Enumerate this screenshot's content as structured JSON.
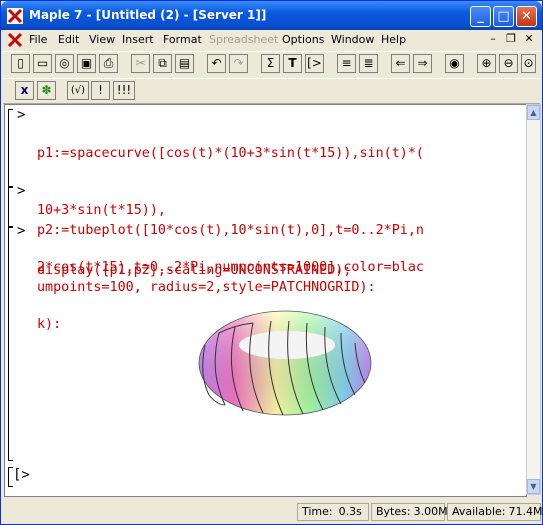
{
  "window": {
    "title": "Maple 7  - [Untitled (2) - [Server 1]]"
  },
  "menu": [
    {
      "label": "File",
      "disabled": false
    },
    {
      "label": "Edit",
      "disabled": false
    },
    {
      "label": "View",
      "disabled": false
    },
    {
      "label": "Insert",
      "disabled": false
    },
    {
      "label": "Format",
      "disabled": false
    },
    {
      "label": "Spreadsheet",
      "disabled": true
    },
    {
      "label": "Options",
      "disabled": false
    },
    {
      "label": "Window",
      "disabled": false
    },
    {
      "label": "Help",
      "disabled": false
    }
  ],
  "toolbar2": {
    "btn3": "(√)",
    "btn4": "!",
    "btn5": "!!!"
  },
  "toolbar1": {
    "sigma": "Σ",
    "text": "T",
    "exec": "[>"
  },
  "document": {
    "prompt_symbol": ">",
    "input1": [
      "p1:=spacecurve([cos(t)*(10+3*sin(t*15)),sin(t)*(",
      "10+3*sin(t*15)),",
      "2*cos(t*15),t=0..2*Pi,numpoints=1000],color=blac",
      "k):"
    ],
    "input2": [
      "p2:=tubeplot([10*cos(t),10*sin(t),0],t=0..2*Pi,n",
      "umpoints=100, radius=2,style=PATCHNOGRID):"
    ],
    "input3": [
      "display({p1,p2},scaling=UNCONSTRAINED);"
    ],
    "last_prompt": "[>"
  },
  "plot": {
    "type": "torus-with-helix",
    "colors": [
      "#ff66cc",
      "#66ccff",
      "#99ff99",
      "#ffff99",
      "#cc99ff"
    ]
  },
  "status": {
    "time_label": "Time:",
    "time_value": "0.3s",
    "bytes_label": "Bytes:",
    "bytes_value": "3.00M",
    "avail_label": "Available:",
    "avail_value": "71.4M"
  }
}
